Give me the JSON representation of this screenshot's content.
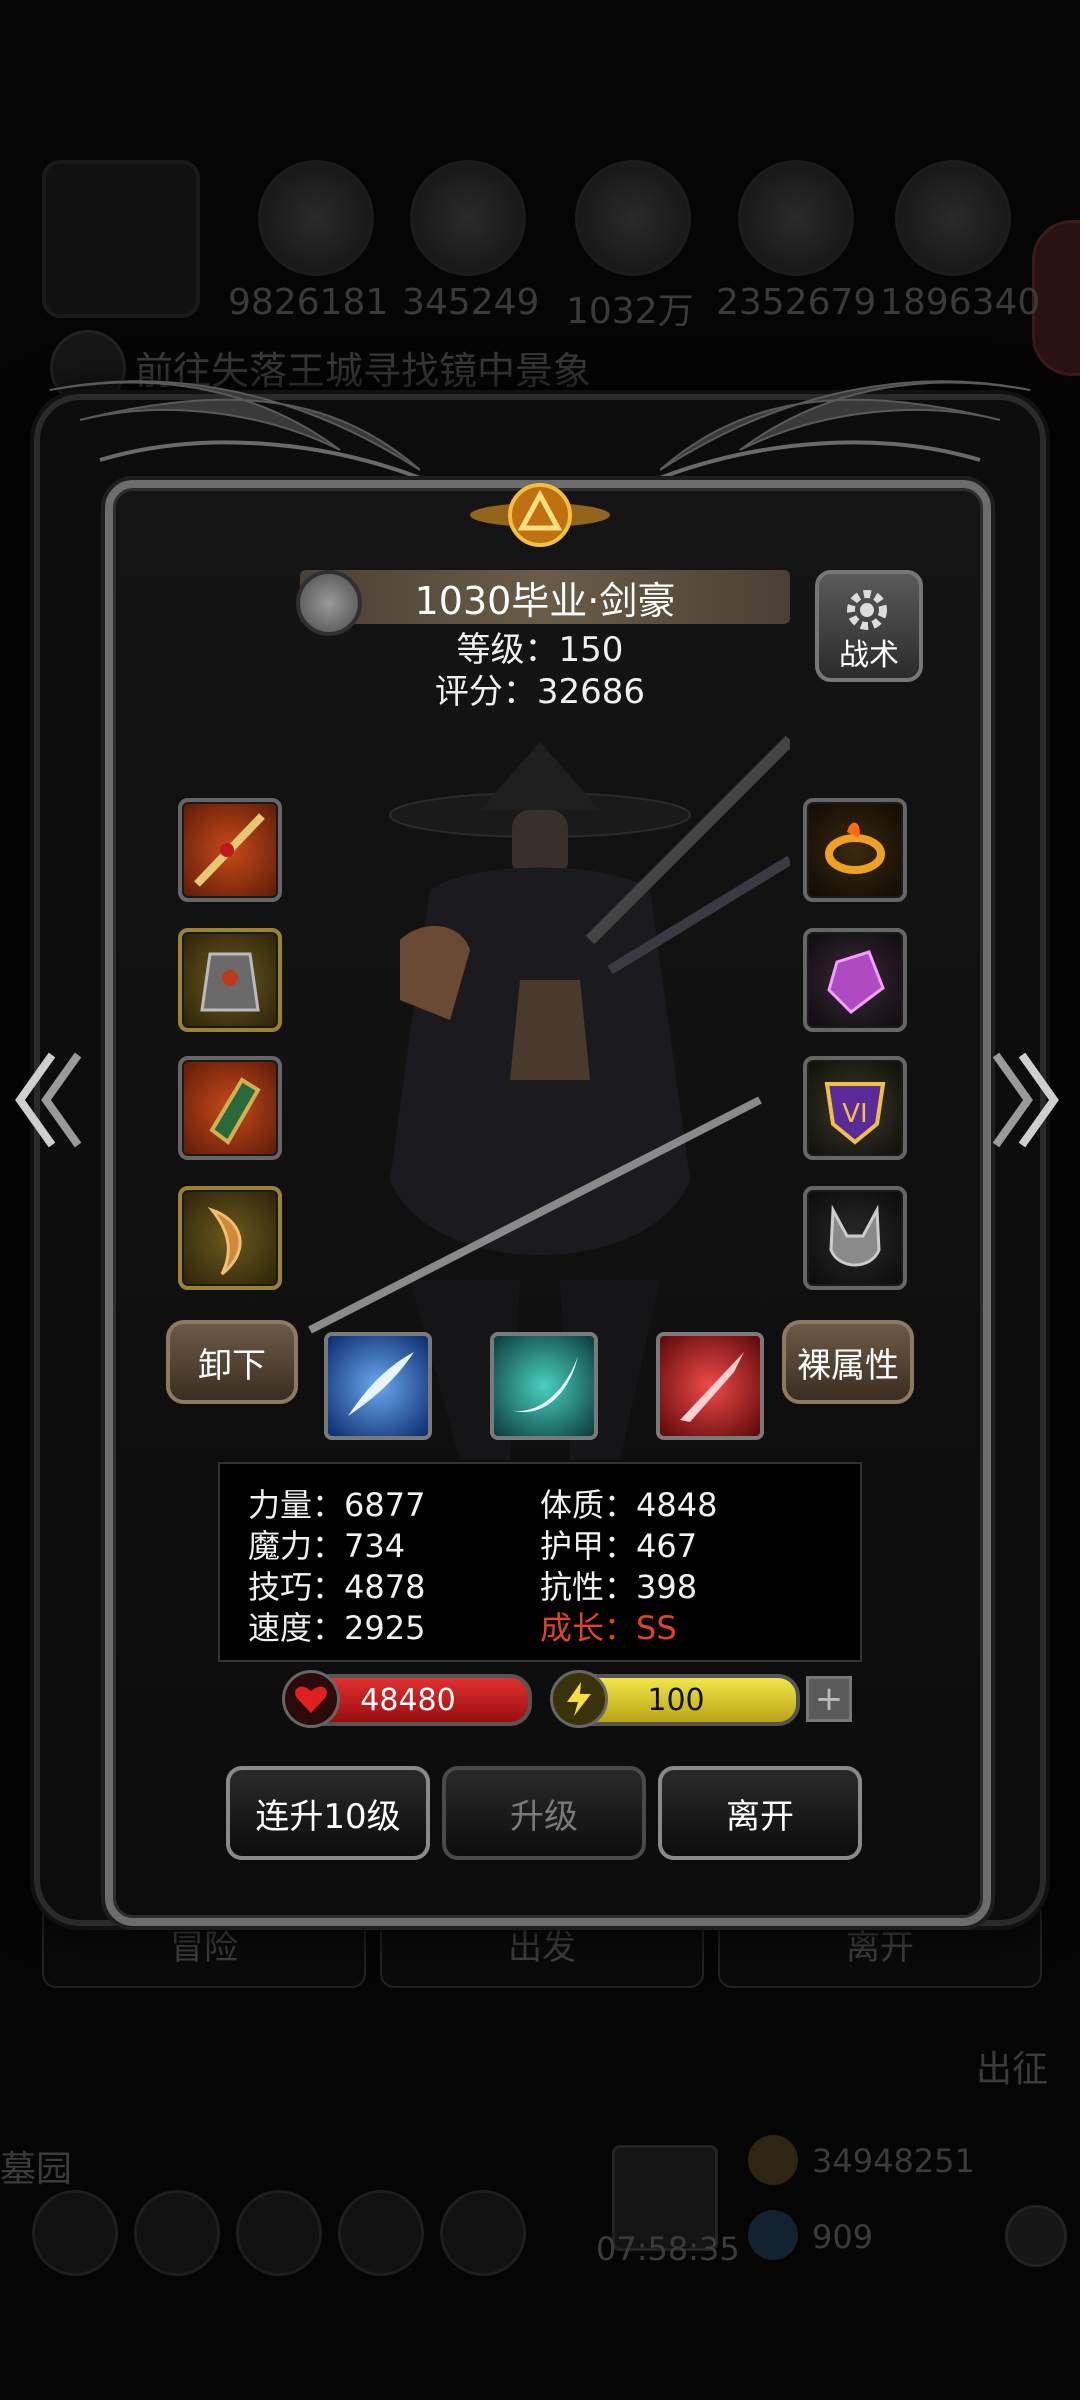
{
  "background": {
    "resources": [
      "9826181",
      "345249",
      "1032万",
      "2352679",
      "1896340"
    ],
    "quest": "前往失落王城寻找镜中景象",
    "buttons": [
      "冒险",
      "出发",
      "离开"
    ],
    "expedition": "出征",
    "cemetery": "墓园",
    "gold": "34948251",
    "gems": "909",
    "timer": "07:58:35"
  },
  "hero": {
    "title": "1030毕业·剑豪",
    "level": "等级：150",
    "score": "评分：32686",
    "tactics_label": "战术"
  },
  "equipment": {
    "left": [
      "sword-icon",
      "armor-icon",
      "bracer-icon",
      "fang-icon"
    ],
    "right": [
      "flame-ring-icon",
      "crystal-icon",
      "rank-badge-icon",
      "mask-icon"
    ]
  },
  "actions": {
    "unequip": "卸下",
    "base_attrs": "裸属性",
    "level_up_10": "连升10级",
    "level_up": "升级",
    "leave": "离开"
  },
  "stats": {
    "strength": "力量：6877",
    "magic": "魔力：734",
    "skill": "技巧：4878",
    "speed": "速度：2925",
    "constitution": "体质：4848",
    "armor": "护甲：467",
    "resistance": "抗性：398",
    "growth": "成长：SS"
  },
  "bars": {
    "hp": "48480",
    "energy": "100",
    "plus": "+"
  },
  "colors": {
    "growth_red": "#e0422a",
    "hp_red": "#c81e1e",
    "energy_yellow": "#e6d52a"
  }
}
